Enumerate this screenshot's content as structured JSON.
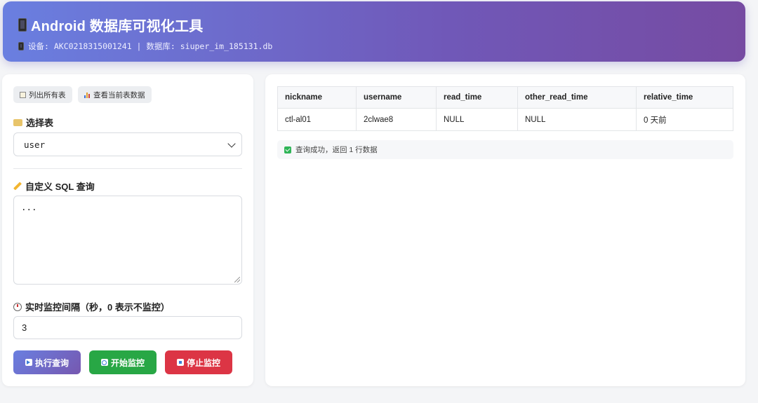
{
  "header": {
    "title": "Android 数据库可视化工具",
    "subtitle": "设备: AKC0218315001241 | 数据库: siuper_im_185131.db"
  },
  "left_panel": {
    "list_tables_label": "列出所有表",
    "view_table_label": "查看当前表数据",
    "select_table_label": "选择表",
    "selected_table": "user",
    "custom_sql_label": "自定义 SQL 查询",
    "sql_value": "...",
    "monitor_label": "实时监控间隔（秒，0 表示不监控）",
    "monitor_value": "3",
    "exec_label": "执行查询",
    "start_label": "开始监控",
    "stop_label": "停止监控"
  },
  "result": {
    "columns": [
      "nickname",
      "username",
      "read_time",
      "other_read_time",
      "relative_time"
    ],
    "rows": [
      [
        "ctl-al01",
        "2clwae8",
        "NULL",
        "NULL",
        "0 天前"
      ]
    ],
    "status_text": "查询成功，返回 1 行数据"
  },
  "colors": {
    "header_gradient_start": "#6a7fe0",
    "header_gradient_end": "#764ba2",
    "start_button": "#28a745",
    "stop_button": "#dc3545",
    "success": "#2fb457"
  },
  "icons": [
    "phone-icon",
    "table-icon",
    "chart-icon",
    "folder-icon",
    "pencil-icon",
    "timer-icon",
    "play-icon",
    "refresh-icon",
    "stop-icon",
    "check-icon"
  ]
}
